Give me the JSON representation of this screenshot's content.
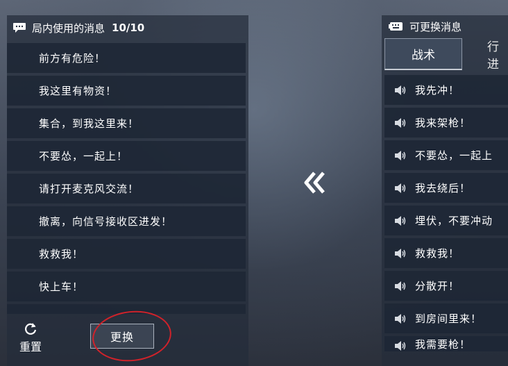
{
  "left_panel": {
    "title": "局内使用的消息",
    "count": "10/10",
    "messages": [
      "前方有危险！",
      "我这里有物资！",
      "集合，到我这里来！",
      "不要怂，一起上！",
      "请打开麦克风交流！",
      "撤离，向信号接收区进发！",
      "救救我！",
      "快上车！"
    ],
    "reset_label": "重置",
    "change_label": "更换"
  },
  "right_panel": {
    "title": "可更换消息",
    "tabs": [
      "战术",
      "行进"
    ],
    "active_tab": "战术",
    "messages": [
      "我先冲！",
      "我来架枪！",
      "不要怂，一起上",
      "我去绕后！",
      "埋伏，不要冲动",
      "救救我！",
      "分散开！",
      "到房间里来！",
      "我需要枪！"
    ]
  },
  "icons": {
    "left_header": "chat-bubble-icon",
    "right_header": "keyboard-icon",
    "reset": "refresh-icon",
    "transfer": "double-chevron-left-icon",
    "message": "speaker-icon"
  },
  "colors": {
    "annotation": "#d0222a",
    "panel_bg": "#242c3a"
  }
}
